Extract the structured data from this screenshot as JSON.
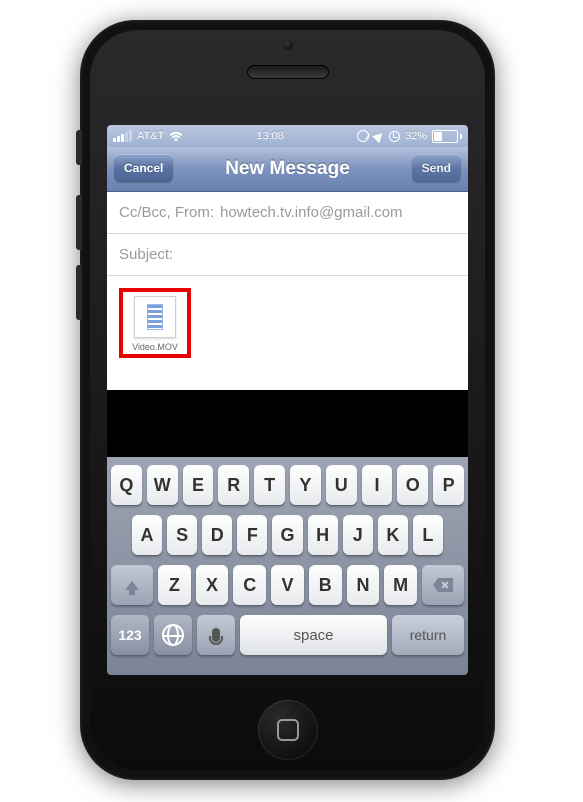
{
  "status": {
    "carrier": "AT&T",
    "time": "13:08",
    "battery_text": "32%"
  },
  "nav": {
    "cancel": "Cancel",
    "title": "New Message",
    "send": "Send"
  },
  "fields": {
    "ccbcc_label": "Cc/Bcc, From:",
    "from_value": "howtech.tv.info@gmail.com",
    "subject_label": "Subject:"
  },
  "attachment": {
    "filename": "Video.MOV"
  },
  "keyboard": {
    "row1": [
      "Q",
      "W",
      "E",
      "R",
      "T",
      "Y",
      "U",
      "I",
      "O",
      "P"
    ],
    "row2": [
      "A",
      "S",
      "D",
      "F",
      "G",
      "H",
      "J",
      "K",
      "L"
    ],
    "row3": [
      "Z",
      "X",
      "C",
      "V",
      "B",
      "N",
      "M"
    ],
    "numkey": "123",
    "space": "space",
    "return": "return"
  }
}
